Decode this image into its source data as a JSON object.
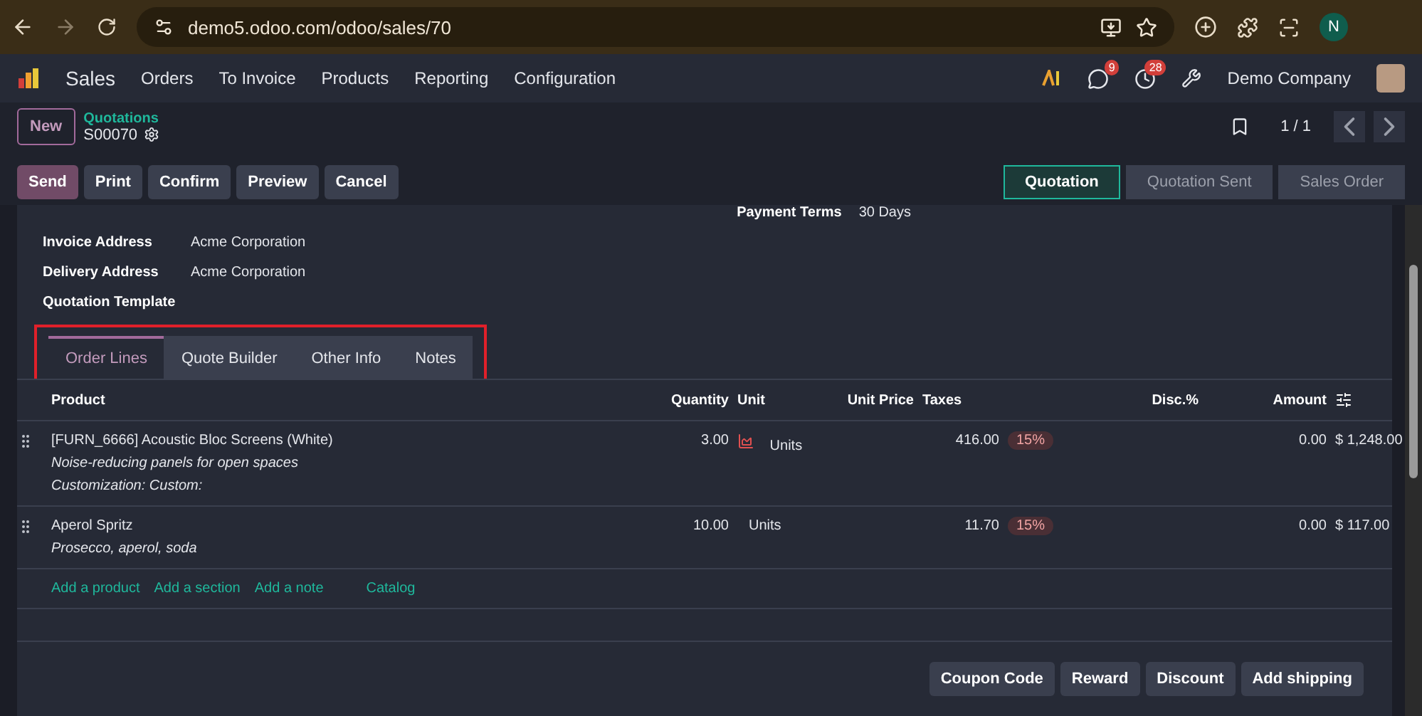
{
  "browser": {
    "url": "demo5.odoo.com/odoo/sales/70",
    "profile": "N"
  },
  "navbar": {
    "app": "Sales",
    "menu": [
      "Orders",
      "To Invoice",
      "Products",
      "Reporting",
      "Configuration"
    ],
    "message_count": "9",
    "activity_count": "28",
    "company": "Demo Company"
  },
  "breadcrumb": {
    "new_button": "New",
    "parent": "Quotations",
    "record": "S00070",
    "pager": "1 / 1"
  },
  "actions": [
    {
      "label": "Send",
      "selected": true
    },
    {
      "label": "Print",
      "selected": false
    },
    {
      "label": "Confirm",
      "selected": false
    },
    {
      "label": "Preview",
      "selected": false
    },
    {
      "label": "Cancel",
      "selected": false
    }
  ],
  "status_steps": [
    {
      "label": "Quotation",
      "selected": true
    },
    {
      "label": "Quotation Sent",
      "selected": false
    },
    {
      "label": "Sales Order",
      "selected": false
    }
  ],
  "payment_terms": {
    "label": "Payment Terms",
    "value": "30 Days"
  },
  "fields": [
    {
      "label": "Invoice Address",
      "value": "Acme Corporation"
    },
    {
      "label": "Delivery Address",
      "value": "Acme Corporation"
    },
    {
      "label": "Quotation Template"
    }
  ],
  "tabs": [
    {
      "label": "Order Lines",
      "selected": true
    },
    {
      "label": "Quote Builder",
      "selected": false
    },
    {
      "label": "Other Info",
      "selected": false
    },
    {
      "label": "Notes",
      "selected": false
    }
  ],
  "table": {
    "columns": [
      "Product",
      "Quantity",
      "Unit",
      "Unit Price",
      "Taxes",
      "Disc.%",
      "Amount"
    ],
    "rows": [
      {
        "product": "[FURN_6666] Acoustic Bloc Screens (White)",
        "notes": [
          "Noise-reducing panels for open spaces",
          "Customization: Custom:"
        ],
        "quantity": "3.00",
        "forecast_warning": true,
        "unit": "Units",
        "unit_price": "416.00",
        "tax": "15%",
        "discount": "0.00",
        "amount": "$ 1,248.00"
      },
      {
        "product": "Aperol Spritz",
        "notes": [
          "Prosecco, aperol, soda"
        ],
        "quantity": "10.00",
        "forecast_warning": false,
        "unit": "Units",
        "unit_price": "11.70",
        "tax": "15%",
        "discount": "0.00",
        "amount": "$ 117.00"
      }
    ],
    "add_links": [
      "Add a product",
      "Add a section",
      "Add a note",
      "Catalog"
    ]
  },
  "footer_buttons": [
    "Coupon Code",
    "Reward",
    "Discount",
    "Add shipping"
  ]
}
